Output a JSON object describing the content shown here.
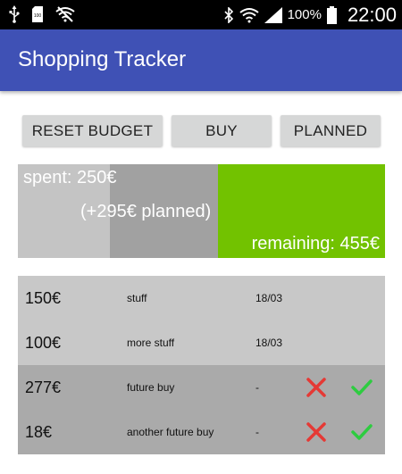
{
  "status_bar": {
    "icons_left": [
      "usb-icon",
      "sd-card-icon",
      "wifi-off-icon"
    ],
    "icons_right": [
      "bluetooth-icon",
      "wifi-icon",
      "signal-icon",
      "battery-icon"
    ],
    "battery_percent": "100%",
    "time": "22:00"
  },
  "app_bar": {
    "title": "Shopping Tracker",
    "color": "#3f51b5"
  },
  "buttons": {
    "reset": "RESET BUDGET",
    "buy": "BUY",
    "planned": "PLANNED"
  },
  "budget": {
    "spent_label": "spent: 250€",
    "planned_label": "(+295€ planned)",
    "remaining_label": "remaining: 455€",
    "spent_value": 250,
    "planned_value": 295,
    "remaining_value": 455,
    "colors": {
      "spent": "#c4c4c4",
      "planned": "#a1a1a1",
      "remaining": "#72c200"
    }
  },
  "items": [
    {
      "amount": "150€",
      "description": "stuff",
      "date": "18/03",
      "planned": false
    },
    {
      "amount": "100€",
      "description": "more stuff",
      "date": "18/03",
      "planned": false
    },
    {
      "amount": "277€",
      "description": "future buy",
      "date": "-",
      "planned": true
    },
    {
      "amount": "18€",
      "description": "another future buy",
      "date": "-",
      "planned": true
    }
  ],
  "action_colors": {
    "cancel": "#e53935",
    "confirm": "#2ecc40"
  }
}
